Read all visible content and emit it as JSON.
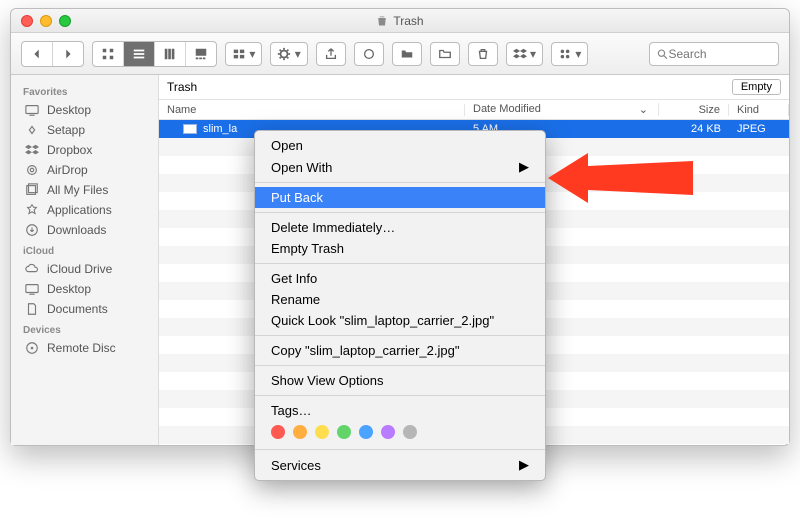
{
  "window": {
    "title": "Trash"
  },
  "sidebar": {
    "sections": [
      {
        "head": "Favorites",
        "items": [
          {
            "label": "Desktop",
            "icon": "desktop"
          },
          {
            "label": "Setapp",
            "icon": "gear"
          },
          {
            "label": "Dropbox",
            "icon": "dropbox"
          },
          {
            "label": "AirDrop",
            "icon": "airdrop"
          },
          {
            "label": "All My Files",
            "icon": "allfiles"
          },
          {
            "label": "Applications",
            "icon": "apps"
          },
          {
            "label": "Downloads",
            "icon": "downloads"
          }
        ]
      },
      {
        "head": "iCloud",
        "items": [
          {
            "label": "iCloud Drive",
            "icon": "cloud"
          },
          {
            "label": "Desktop",
            "icon": "desktop"
          },
          {
            "label": "Documents",
            "icon": "doc"
          }
        ]
      },
      {
        "head": "Devices",
        "items": [
          {
            "label": "Remote Disc",
            "icon": "disc"
          }
        ]
      }
    ]
  },
  "pathbar": {
    "title": "Trash",
    "empty": "Empty"
  },
  "columns": {
    "name": "Name",
    "date": "Date Modified",
    "size": "Size",
    "kind": "Kind"
  },
  "files": [
    {
      "name": "slim_la",
      "date": "5 AM",
      "size": "24 KB",
      "kind": "JPEG"
    }
  ],
  "search_placeholder": "Search",
  "context_menu": {
    "open": "Open",
    "open_with": "Open With",
    "put_back": "Put Back",
    "delete_immediately": "Delete Immediately…",
    "empty_trash": "Empty Trash",
    "get_info": "Get Info",
    "rename": "Rename",
    "quick_look": "Quick Look \"slim_laptop_carrier_2.jpg\"",
    "copy": "Copy \"slim_laptop_carrier_2.jpg\"",
    "show_view_options": "Show View Options",
    "tags": "Tags…",
    "services": "Services",
    "tag_colors": [
      "#ff5a52",
      "#ffae3f",
      "#ffdd4f",
      "#62d46a",
      "#4aa3ff",
      "#b97bff",
      "#b6b6b6"
    ]
  }
}
